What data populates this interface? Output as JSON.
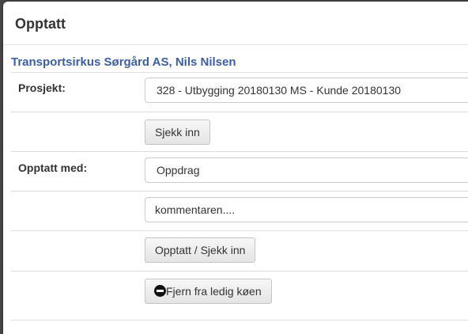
{
  "dialog": {
    "title": "Opptatt",
    "customer": "Transportsirkus Sørgård AS, Nils Nilsen"
  },
  "project": {
    "label": "Prosjekt:",
    "selected": "328 - Utbygging 20180130 MS - Kunde 20180130",
    "checkin_button": "Sjekk inn"
  },
  "busy": {
    "label": "Opptatt med:",
    "selected": "Oppdrag",
    "comment_placeholder": "kommentaren....",
    "busy_checkin_button": "Opptatt / Sjekk inn",
    "remove_queue_button": "Fjern fra ledig køen",
    "remove_icon": "minus-circle-icon"
  }
}
